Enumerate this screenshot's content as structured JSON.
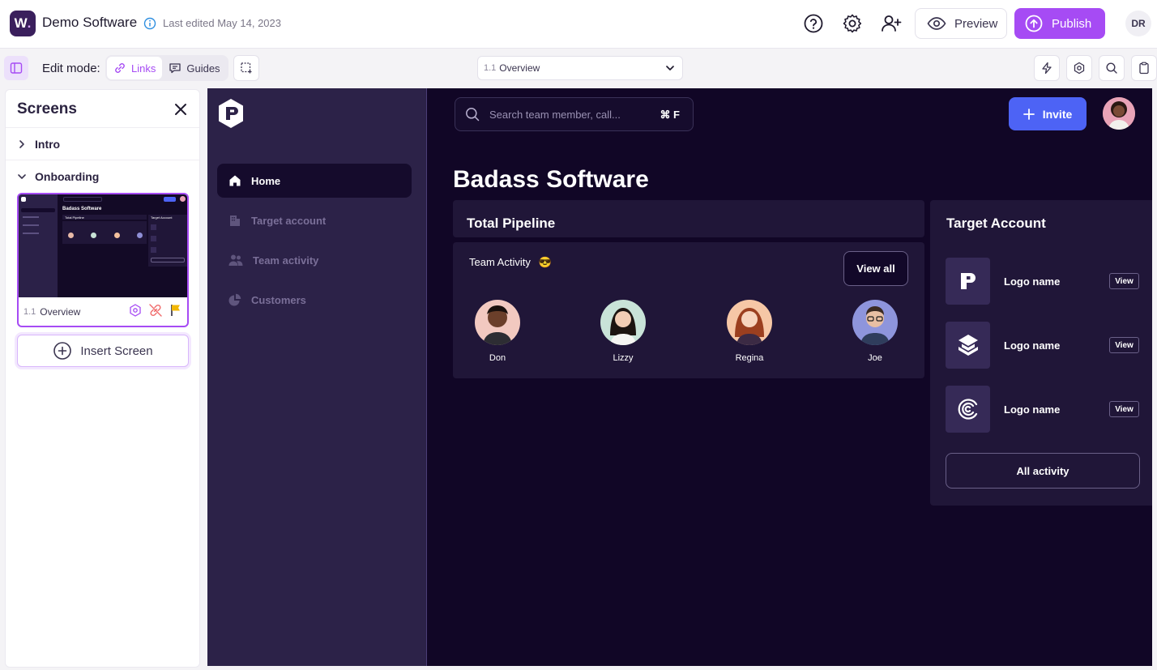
{
  "topbar": {
    "logo_letter": "W",
    "logo_dot": ".",
    "app_title": "Demo Software",
    "last_edited": "Last edited May 14, 2023",
    "icons": [
      "help-icon",
      "settings-icon",
      "add-user-icon"
    ],
    "preview_label": "Preview",
    "publish_label": "Publish",
    "user_initials": "DR"
  },
  "toolbar": {
    "edit_mode_label": "Edit mode:",
    "links_label": "Links",
    "guides_label": "Guides",
    "screen_select": {
      "number": "1.1",
      "label": "Overview"
    },
    "right_icons": [
      "lightning-icon",
      "hexagon-settings-icon",
      "search-icon",
      "clipboard-icon"
    ]
  },
  "screens_panel": {
    "title": "Screens",
    "groups": [
      {
        "label": "Intro",
        "expanded": false
      },
      {
        "label": "Onboarding",
        "expanded": true
      }
    ],
    "selected_screen": {
      "number": "1.1",
      "label": "Overview"
    },
    "thumbnail": {
      "heading": "Badass Software",
      "card1": "Total Pipeline",
      "card2": "Target Account"
    },
    "insert_label": "Insert Screen"
  },
  "app": {
    "nav": [
      {
        "label": "Home",
        "icon": "home-icon",
        "active": true
      },
      {
        "label": "Target account",
        "icon": "building-icon",
        "active": false
      },
      {
        "label": "Team activity",
        "icon": "team-icon",
        "active": false
      },
      {
        "label": "Customers",
        "icon": "pie-chart-icon",
        "active": false
      }
    ],
    "search_placeholder": "Search team member, call...",
    "search_shortcut": "⌘ F",
    "invite_label": "Invite",
    "page_title": "Badass Software",
    "total_pipeline_title": "Total Pipeline",
    "team_activity": {
      "title": "Team Activity",
      "emoji": "😎",
      "view_all_label": "View all",
      "members": [
        "Don",
        "Lizzy",
        "Regina",
        "Joe"
      ]
    },
    "target_account": {
      "title": "Target Account",
      "rows": [
        {
          "name": "Logo name",
          "view": "View",
          "icon": "p-logo-icon"
        },
        {
          "name": "Logo name",
          "view": "View",
          "icon": "layers-logo-icon"
        },
        {
          "name": "Logo name",
          "view": "View",
          "icon": "spiral-logo-icon"
        }
      ],
      "all_activity_label": "All activity"
    }
  },
  "colors": {
    "accent_purple": "#a64bf4",
    "invite_blue": "#4d63f5",
    "canvas_bg": "#110626",
    "sidebar_bg": "#2c2248",
    "card_bg": "#201638"
  }
}
